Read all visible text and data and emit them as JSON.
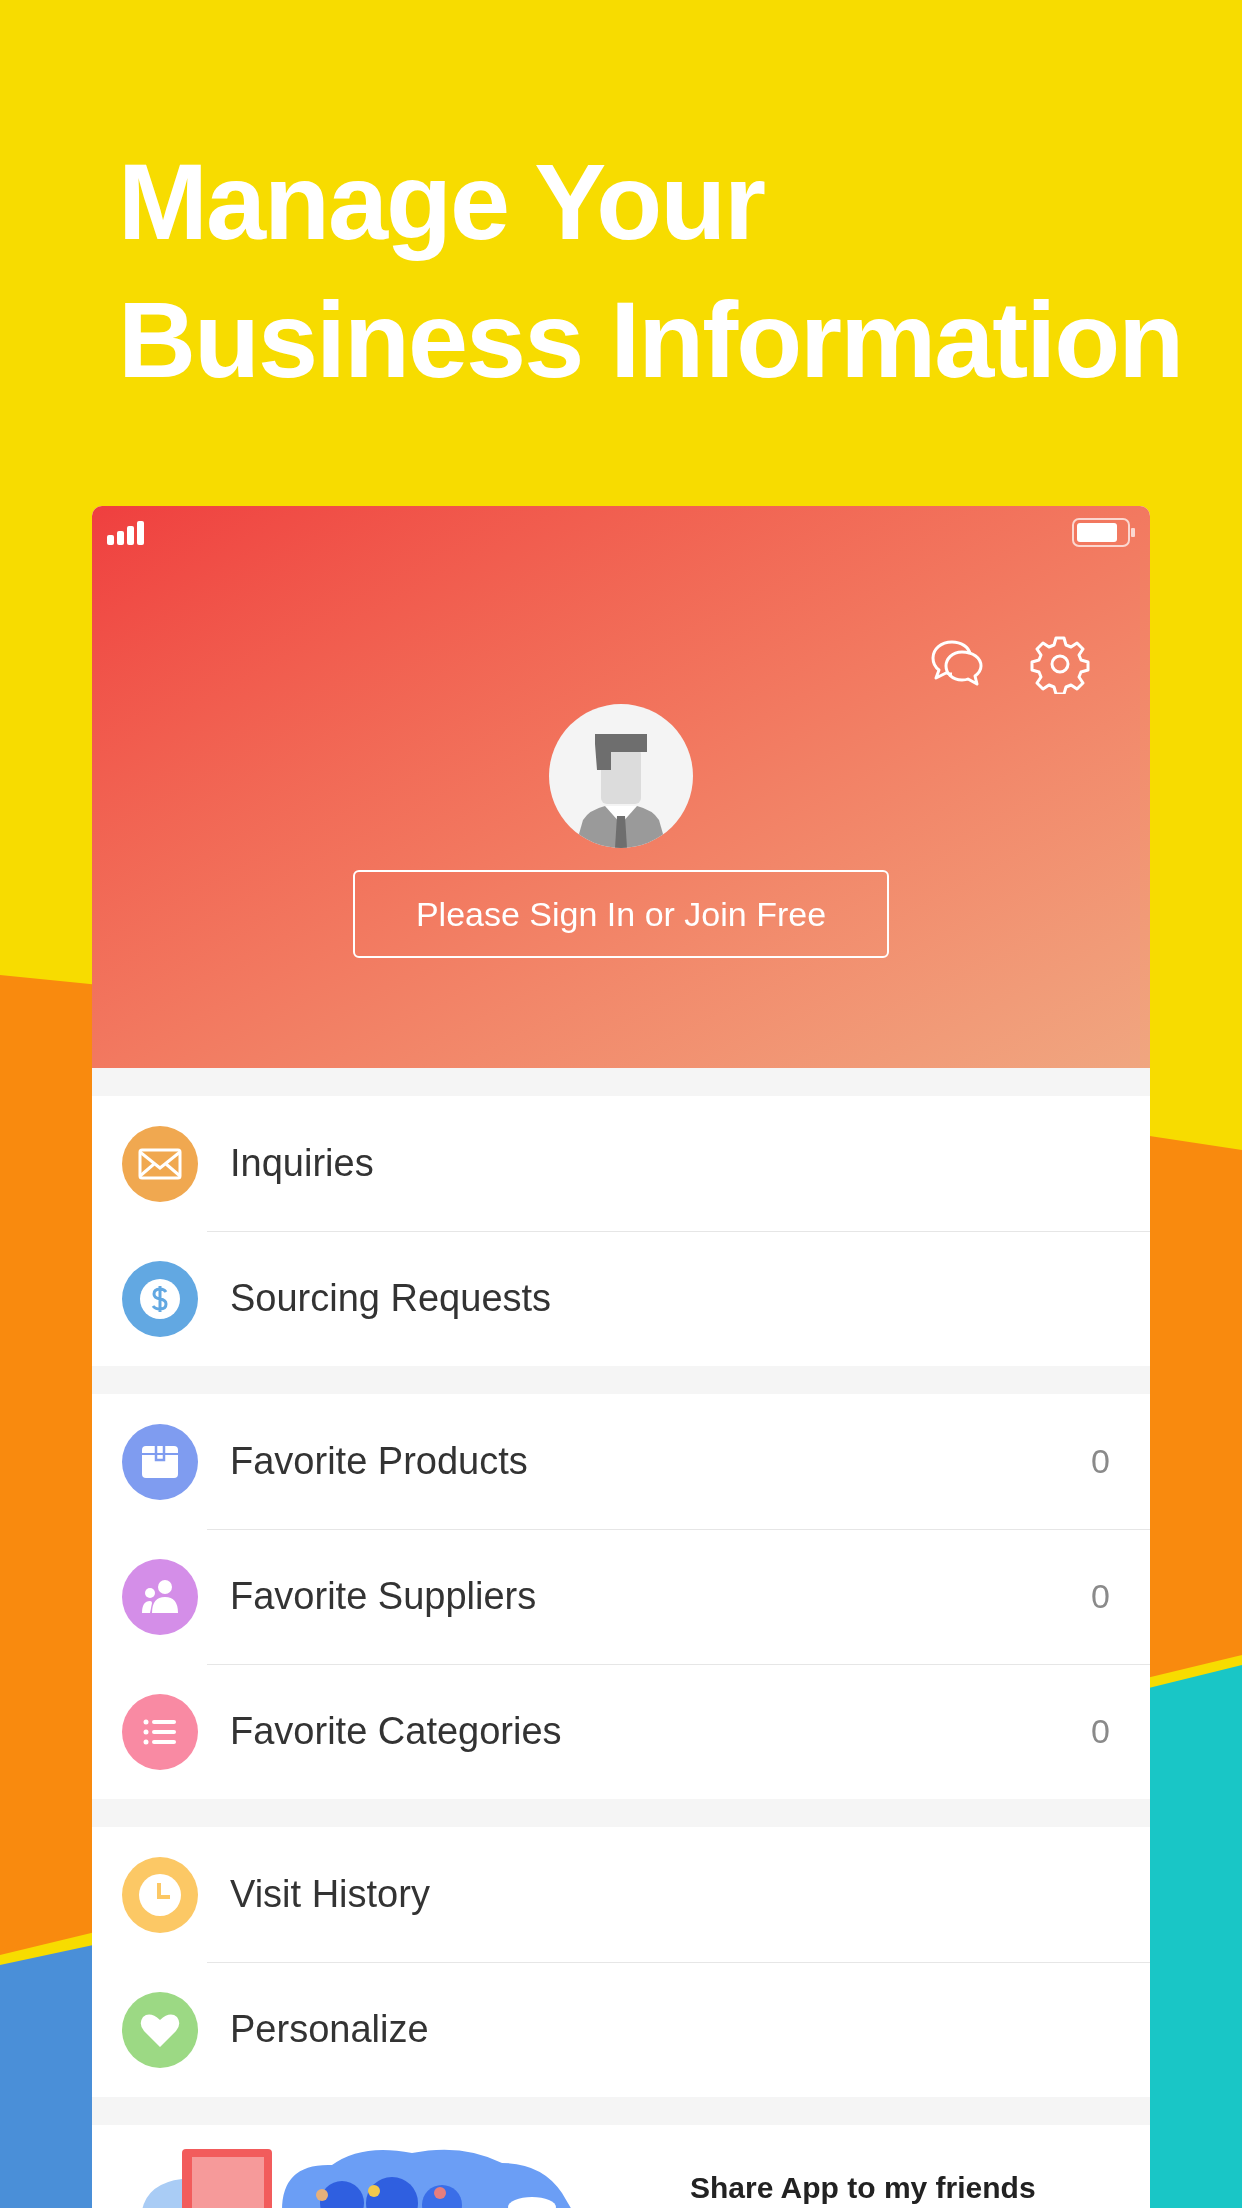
{
  "headline": [
    "Manage Your",
    "Business Information"
  ],
  "header": {
    "sign_in_button": "Please Sign In or Join Free"
  },
  "sections": [
    {
      "items": [
        {
          "label": "Inquiries",
          "kind": "mail",
          "color": "#f0a850"
        },
        {
          "label": "Sourcing Requests",
          "kind": "dollar",
          "color": "#62a8e2"
        }
      ]
    },
    {
      "items": [
        {
          "label": "Favorite Products",
          "count": "0",
          "kind": "box",
          "color": "#7f9cf0"
        },
        {
          "label": "Favorite Suppliers",
          "count": "0",
          "kind": "people",
          "color": "#d48ee8"
        },
        {
          "label": "Favorite Categories",
          "count": "0",
          "kind": "list",
          "color": "#f98aa3"
        }
      ]
    },
    {
      "items": [
        {
          "label": "Visit History",
          "kind": "clock",
          "color": "#fcc865"
        },
        {
          "label": "Personalize",
          "kind": "heart",
          "color": "#9cd984"
        }
      ]
    }
  ],
  "share": {
    "title": "Share App to my friends"
  }
}
